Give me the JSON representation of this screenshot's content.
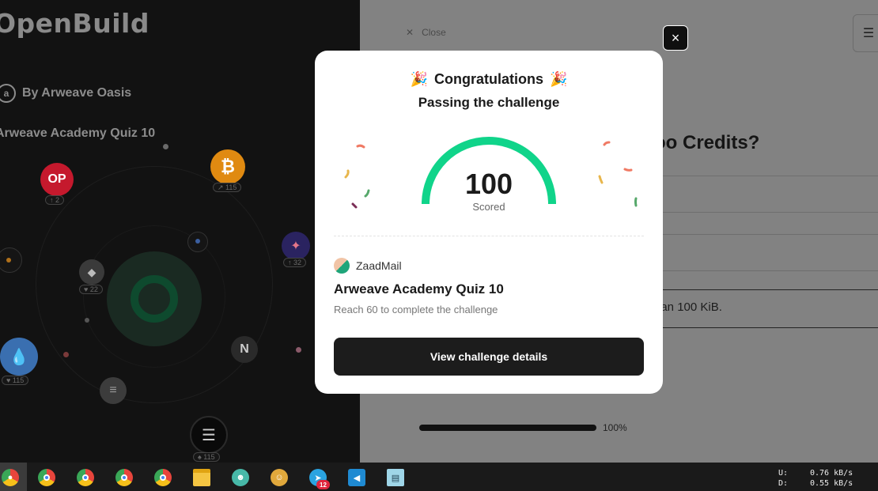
{
  "left_panel": {
    "brand": "OpenBuild",
    "byline_icon": "arweave-icon",
    "byline": "By Arweave Oasis",
    "quiz_name": "Arweave Academy Quiz 10",
    "coins": [
      {
        "name": "op-coin",
        "label": "OP",
        "badge": "2"
      },
      {
        "name": "bitcoin-coin",
        "label": "₿",
        "badge": "115"
      },
      {
        "name": "ethereum-coin",
        "label": "◆",
        "badge": "22"
      },
      {
        "name": "starknet-coin",
        "label": "✦",
        "badge": "32"
      },
      {
        "name": "sui-coin",
        "label": "💧",
        "badge": "115"
      },
      {
        "name": "near-coin",
        "label": "N",
        "badge": ""
      },
      {
        "name": "solana-coin",
        "label": "≡",
        "badge": ""
      },
      {
        "name": "aptos-coin",
        "label": "☰",
        "badge": "115"
      }
    ]
  },
  "right_panel": {
    "close_label": "Close",
    "question_fragment": "oo Credits?",
    "answer_fragment": "han 100 KiB.",
    "progress": 1.0,
    "progress_label": "100%"
  },
  "modal": {
    "close_icon": "×",
    "congrats": "Congratulations",
    "subtitle": "Passing the challenge",
    "score": "100",
    "score_label": "Scored",
    "author": "ZaadMail",
    "challenge_title": "Arweave Academy Quiz 10",
    "challenge_desc": "Reach 60 to complete the challenge",
    "button_label": "View challenge details",
    "gauge_color": "#10d48a"
  },
  "taskbar": {
    "items": [
      "chrome-profile-1",
      "chrome-profile-2",
      "chrome-profile-3",
      "chrome-profile-4",
      "chrome-profile-5",
      "file-explorer",
      "app-1",
      "app-2",
      "telegram",
      "vscode",
      "notepad"
    ],
    "telegram_badge": "12",
    "upload_label": "U:",
    "upload_value": "0.76 kB/s",
    "download_label": "D:",
    "download_value": "0.55 kB/s"
  }
}
